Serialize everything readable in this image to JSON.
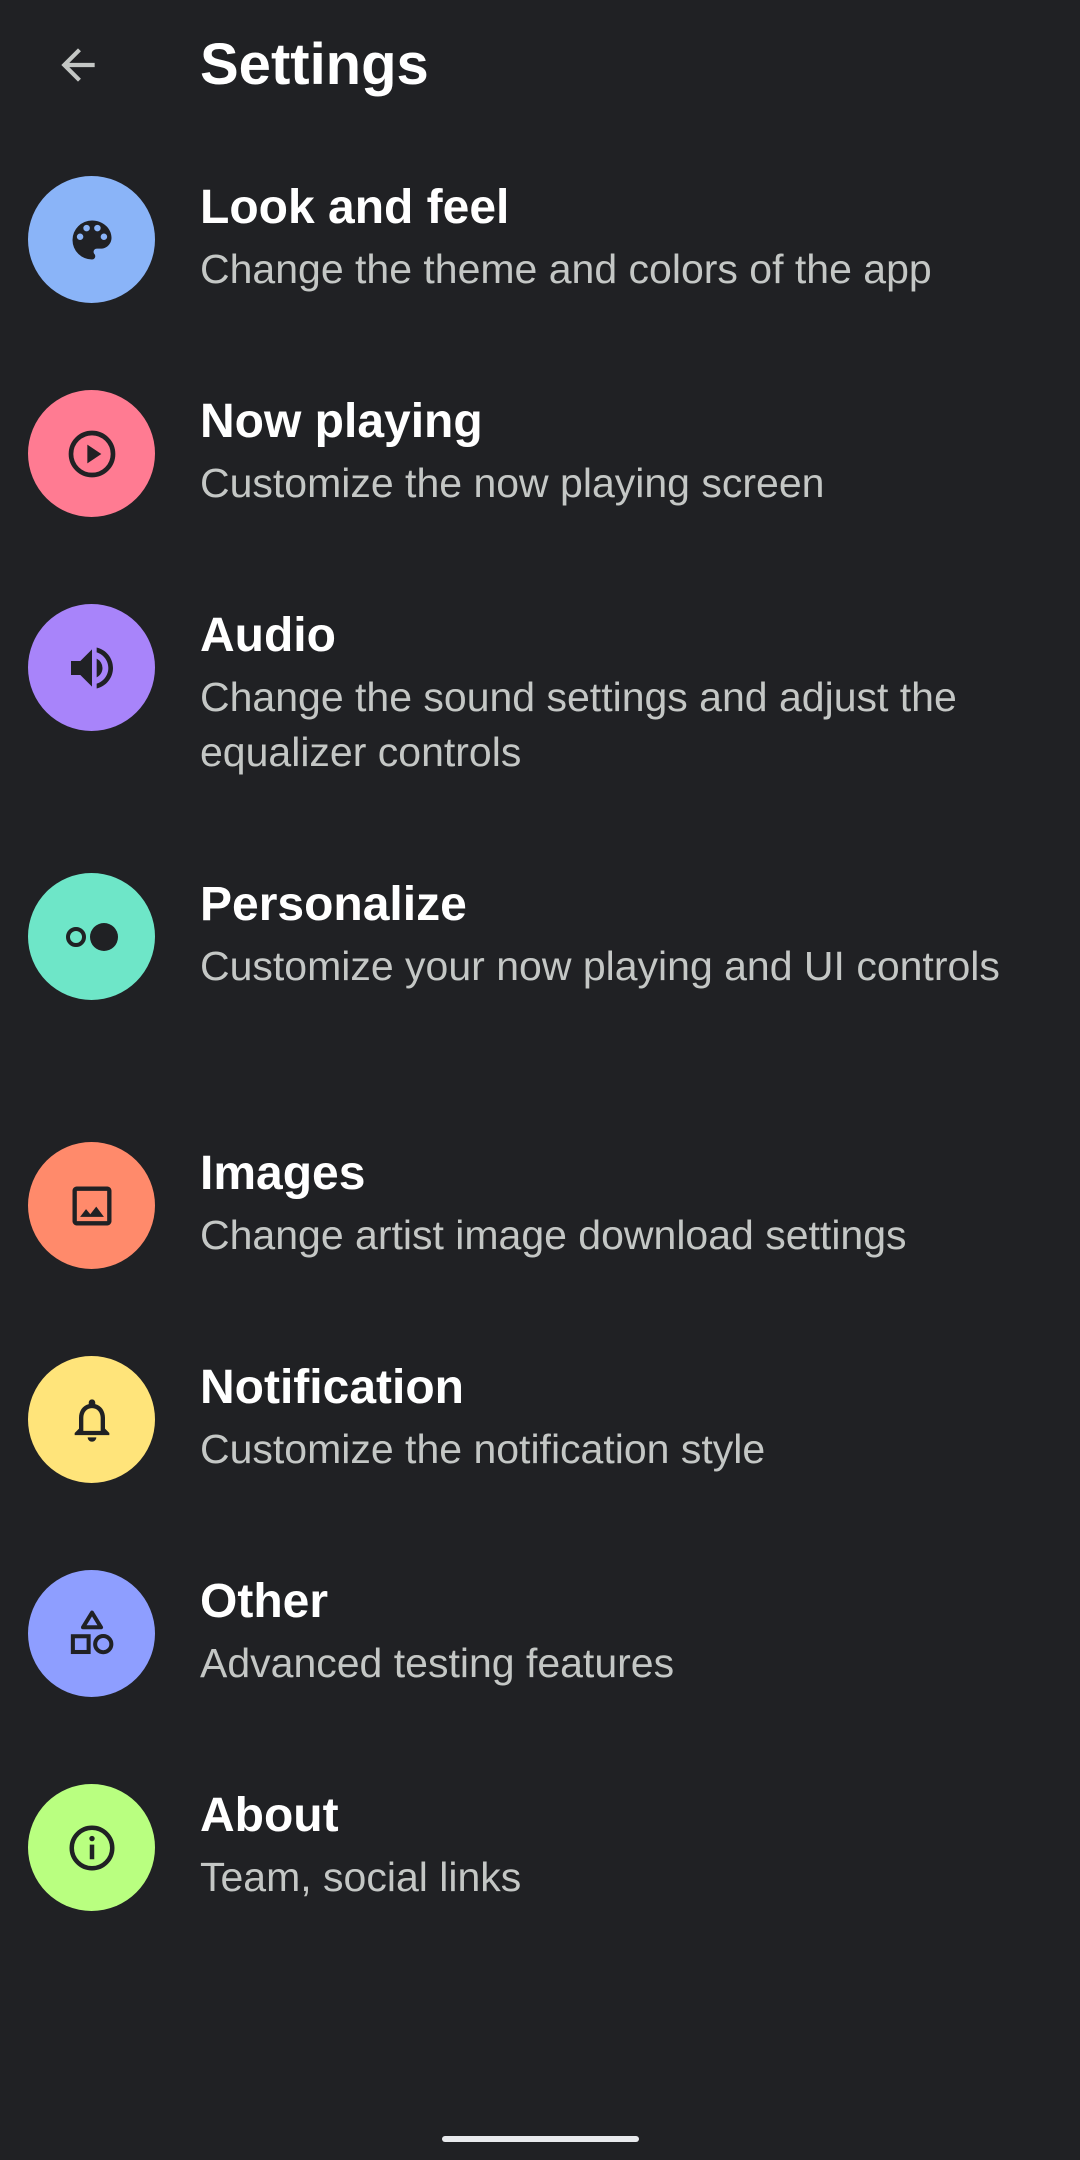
{
  "header": {
    "title": "Settings",
    "back_icon": "arrow-back-icon"
  },
  "items": [
    {
      "title": "Look and feel",
      "subtitle": "Change the theme and colors of the app",
      "icon": "palette-icon",
      "color": "#8AB4F8"
    },
    {
      "title": "Now playing",
      "subtitle": "Customize the now playing screen",
      "icon": "play-circle-icon",
      "color": "#FF7B92"
    },
    {
      "title": "Audio",
      "subtitle": "Change the sound settings and adjust the equalizer controls",
      "icon": "volume-icon",
      "color": "#A884FA"
    },
    {
      "title": "Personalize",
      "subtitle": "Customize your now playing and UI controls",
      "icon": "toggle-icon",
      "color": "#6EE6C8"
    },
    {
      "title": "Images",
      "subtitle": "Change artist image download settings",
      "icon": "image-icon",
      "color": "#FF8A6B"
    },
    {
      "title": "Notification",
      "subtitle": "Customize the notification style",
      "icon": "bell-icon",
      "color": "#FFE47A"
    },
    {
      "title": "Other",
      "subtitle": "Advanced testing features",
      "icon": "shapes-icon",
      "color": "#8E9EFF"
    },
    {
      "title": "About",
      "subtitle": "Team, social links",
      "icon": "info-icon",
      "color": "#B9FF80"
    }
  ]
}
